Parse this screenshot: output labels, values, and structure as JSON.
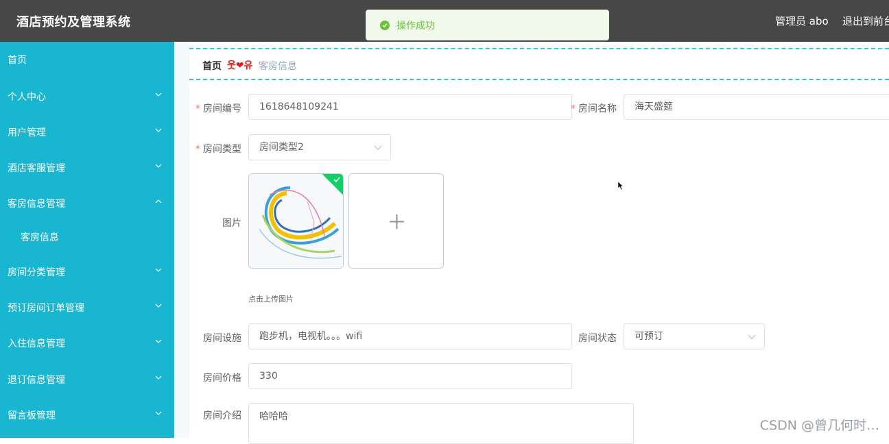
{
  "header": {
    "app_title": "酒店预约及管理系统",
    "admin_label": "管理员 abo",
    "exit_label": "退出到前台"
  },
  "toast": {
    "message": "操作成功",
    "icon": "success-check-icon",
    "color": "#67c23a"
  },
  "sidebar": {
    "bg_color": "#19b6d2",
    "items": [
      {
        "label": "首页"
      },
      {
        "label": "个人中心"
      },
      {
        "label": "用户管理"
      },
      {
        "label": "酒店客服管理"
      },
      {
        "label": "客房信息管理",
        "expanded": true
      },
      {
        "label": "客房信息"
      },
      {
        "label": "房间分类管理"
      },
      {
        "label": "预订房间订单管理"
      },
      {
        "label": "入住信息管理"
      },
      {
        "label": "退订信息管理"
      },
      {
        "label": "留言板管理"
      }
    ]
  },
  "breadcrumb": {
    "home": "首页",
    "separator": "웃❤유",
    "current": "客房信息"
  },
  "form": {
    "room_no": {
      "label": "房间编号",
      "value": "1618648109241",
      "required": true
    },
    "room_name": {
      "label": "房间名称",
      "value": "海天盛筵",
      "required": true
    },
    "room_type": {
      "label": "房间类型",
      "value": "房间类型2",
      "required": true
    },
    "picture": {
      "label": "图片",
      "tip": "点击上传图片"
    },
    "facilities": {
      "label": "房间设施",
      "value": "跑步机，电视机。。。wifi"
    },
    "status": {
      "label": "房间状态",
      "value": "可预订"
    },
    "price": {
      "label": "房间价格",
      "value": "330"
    },
    "intro": {
      "label": "房间介绍",
      "value": "哈哈哈"
    }
  },
  "watermark": "CSDN @曾几何时…"
}
